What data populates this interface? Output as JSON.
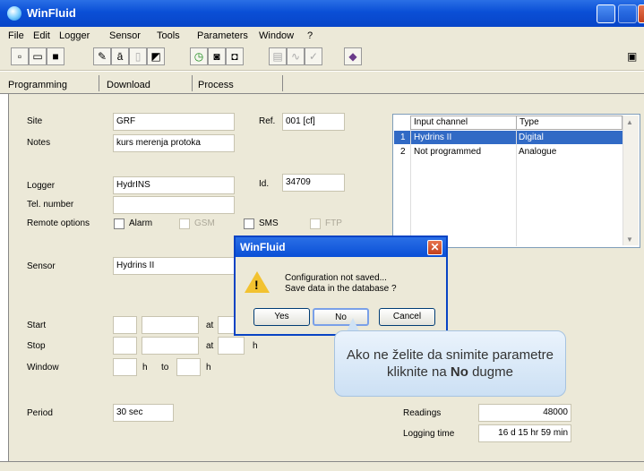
{
  "window": {
    "title": "WinFluid"
  },
  "menu": [
    "File",
    "Edit",
    "Logger",
    "Sensor",
    "Tools",
    "Parameters",
    "Window",
    "?"
  ],
  "tabs": [
    "Programming",
    "Download",
    "Process"
  ],
  "form": {
    "site_label": "Site",
    "site_value": "GRF",
    "ref_label": "Ref.",
    "ref_value": "001  [cf]",
    "notes_label": "Notes",
    "notes_value": "kurs merenja protoka",
    "logger_label": "Logger",
    "logger_value": "HydrINS",
    "id_label": "Id.",
    "id_value": "34709",
    "tel_label": "Tel. number",
    "tel_value": "",
    "remote_label": "Remote options",
    "opt_alarm": "Alarm",
    "opt_gsm": "GSM",
    "opt_sms": "SMS",
    "opt_ftp": "FTP",
    "sensor_label": "Sensor",
    "sensor_value": "Hydrins II",
    "start_label": "Start",
    "stop_label": "Stop",
    "window_label": "Window",
    "at": "at",
    "h": "h",
    "to": "to",
    "period_label": "Period",
    "period_value": "30 sec",
    "readings_label": "Readings",
    "readings_value": "48000",
    "logtime_label": "Logging time",
    "logtime_value": "16 d 15 hr 59 min"
  },
  "channels": {
    "headers": [
      "Input channel",
      "Type"
    ],
    "rows": [
      {
        "num": "1",
        "channel": "Hydrins II",
        "type": "Digital",
        "selected": true
      },
      {
        "num": "2",
        "channel": "Not programmed",
        "type": "Analogue",
        "selected": false
      }
    ]
  },
  "dialog": {
    "title": "WinFluid",
    "line1": "Configuration not saved...",
    "line2": "Save data in the database ?",
    "yes": "Yes",
    "no": "No",
    "cancel": "Cancel"
  },
  "callout": {
    "line1": "Ako ne želite da snimite parametre",
    "line2_pre": "kliknite na ",
    "line2_bold": "No",
    "line2_post": " dugme"
  },
  "colors": {
    "selection": "#316ac5",
    "titlebar": "#0a4fd6"
  }
}
